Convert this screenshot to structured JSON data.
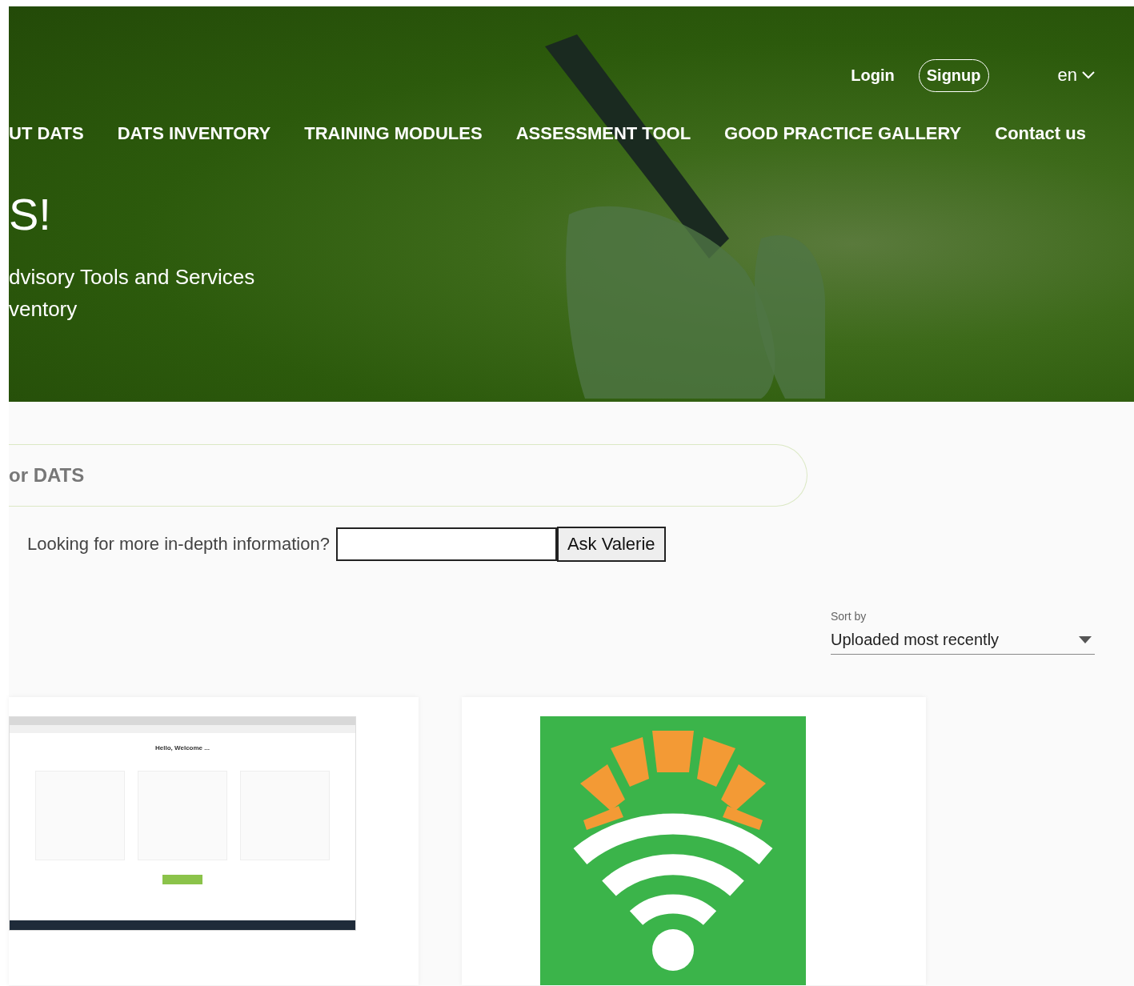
{
  "header": {
    "auth": [
      {
        "label": "Login",
        "kind": "link"
      },
      {
        "label": "Signup",
        "kind": "pill"
      }
    ],
    "language": {
      "label": "en"
    },
    "nav": [
      {
        "label": "UT DATS"
      },
      {
        "label": "DATS INVENTORY"
      },
      {
        "label": "TRAINING MODULES"
      },
      {
        "label": "ASSESSMENT TOOL"
      },
      {
        "label": "GOOD PRACTICE GALLERY"
      },
      {
        "label": "Contact us"
      }
    ]
  },
  "hero": {
    "title": "S!",
    "subtitle_lines": [
      "dvisory Tools and Services",
      "ventory"
    ]
  },
  "search": {
    "placeholder": "or DATS"
  },
  "ask": {
    "label": "Looking for more in-depth information?",
    "button": "Ask Valerie"
  },
  "sort": {
    "label": "Sort by",
    "value": "Uploaded most recently"
  },
  "cards": [
    {
      "kind": "screenshot",
      "heading": "Hello, Welcome ..."
    },
    {
      "kind": "logo"
    }
  ]
}
